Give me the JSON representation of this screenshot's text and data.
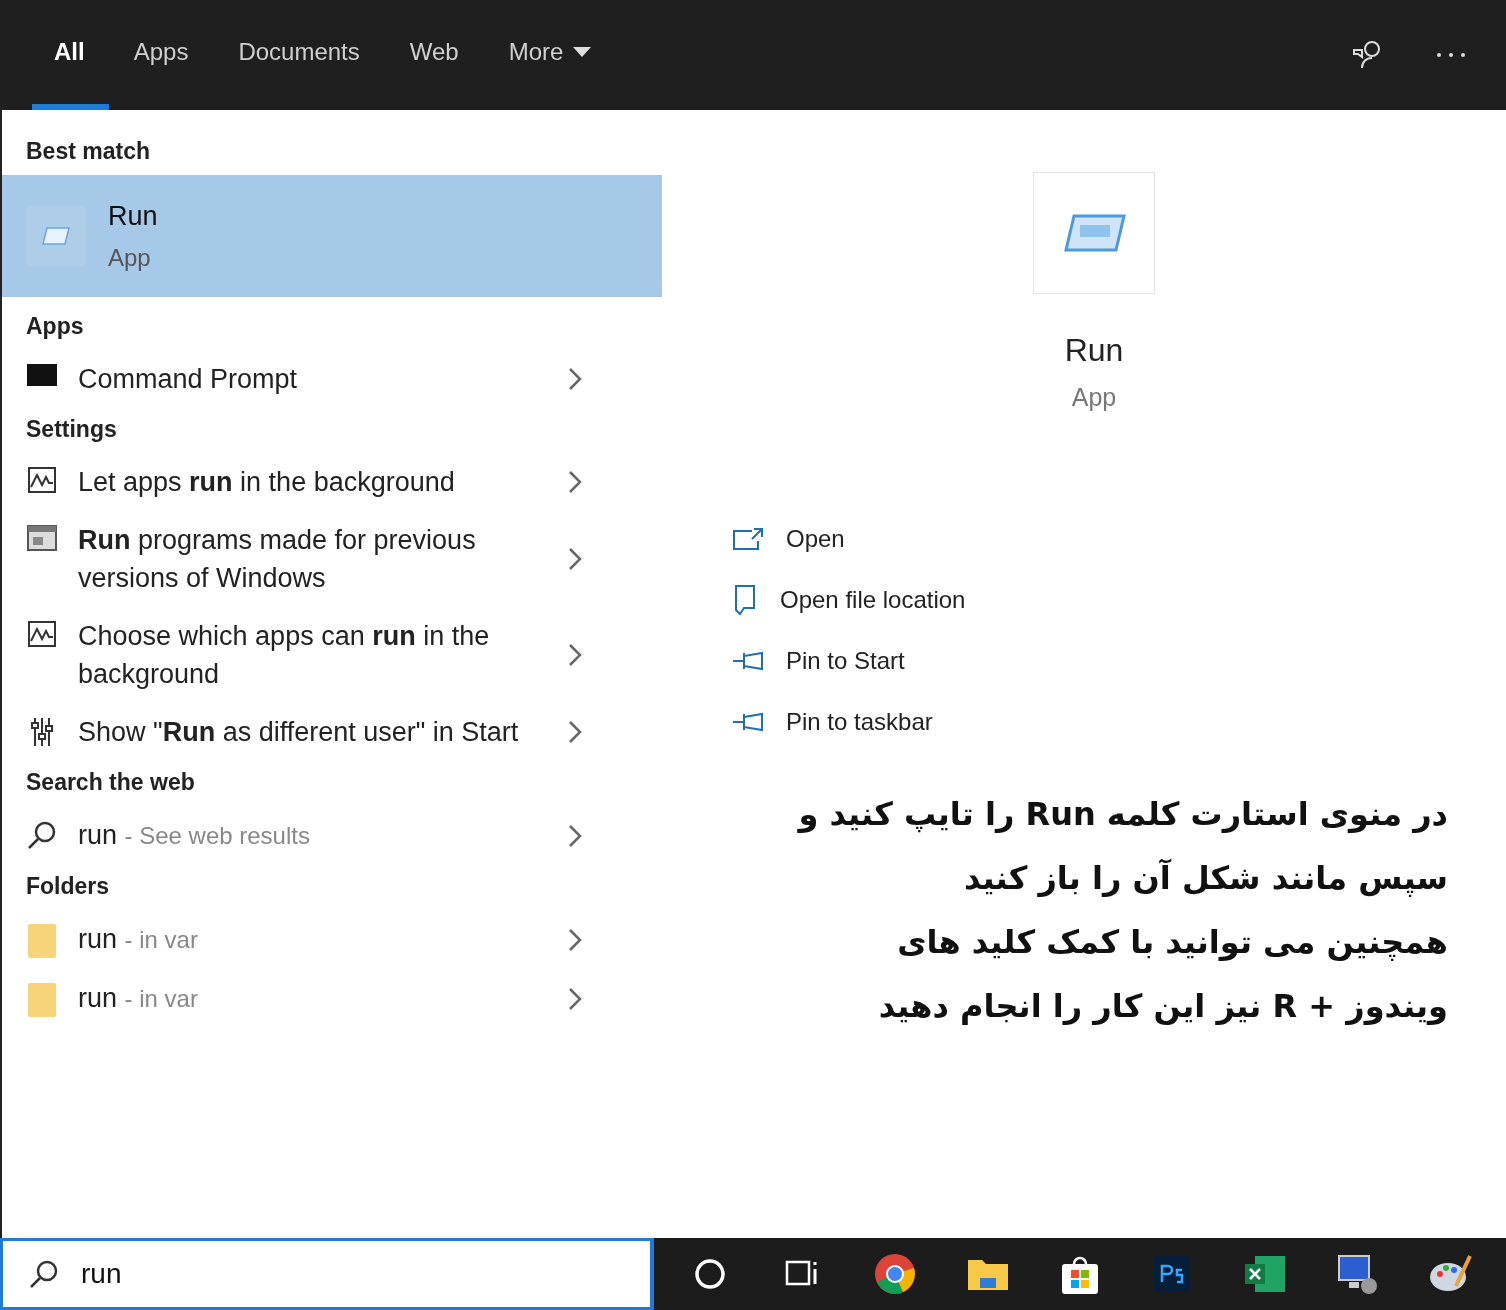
{
  "tabs": [
    {
      "label": "All",
      "selected": true
    },
    {
      "label": "Apps",
      "selected": false
    },
    {
      "label": "Documents",
      "selected": false
    },
    {
      "label": "Web",
      "selected": false
    },
    {
      "label": "More",
      "selected": false
    }
  ],
  "sections": [
    {
      "heading": "Best match",
      "items": [
        {
          "kind": "best",
          "title": "Run",
          "subtitle": "App",
          "selected": true
        }
      ]
    },
    {
      "heading": "Apps",
      "items": [
        {
          "kind": "console",
          "title": "Command Prompt",
          "selected": false
        }
      ]
    },
    {
      "heading": "Settings",
      "items": [
        {
          "kind": "chart",
          "title": "Let apps **run** in the background",
          "selected": false
        },
        {
          "kind": "window",
          "title": "**Run** programs made for previous versions of Windows",
          "selected": false
        },
        {
          "kind": "chart",
          "title": "Choose which apps can **run** in the background",
          "selected": false
        },
        {
          "kind": "sliders",
          "title": "Show \"**Run** as different user\" in Start",
          "selected": false
        }
      ]
    },
    {
      "heading": "Search the web",
      "items": [
        {
          "kind": "search",
          "title": "run",
          "subtitle": "- See web results",
          "selected": false
        }
      ]
    },
    {
      "heading": "Folders",
      "items": [
        {
          "kind": "folder",
          "title": "run",
          "subtitle": "- in var",
          "selected": false
        },
        {
          "kind": "folder",
          "title": "run",
          "subtitle": "- in var",
          "selected": false
        }
      ]
    }
  ],
  "preview": {
    "title": "Run",
    "subtitle": "App",
    "actions": [
      {
        "label": "Open"
      },
      {
        "label": "Open file location"
      },
      {
        "label": "Pin to Start"
      },
      {
        "label": "Pin to taskbar"
      }
    ]
  },
  "annotation": [
    "در منوی استارت کلمه **Run** را تایپ کنید و",
    "سپس مانند شکل آن را باز کنید",
    "همچنین می توانید با کمک کلید های",
    "ویندوز + **R** نیز این کار را انجام دهید"
  ],
  "search": {
    "value": "run"
  }
}
